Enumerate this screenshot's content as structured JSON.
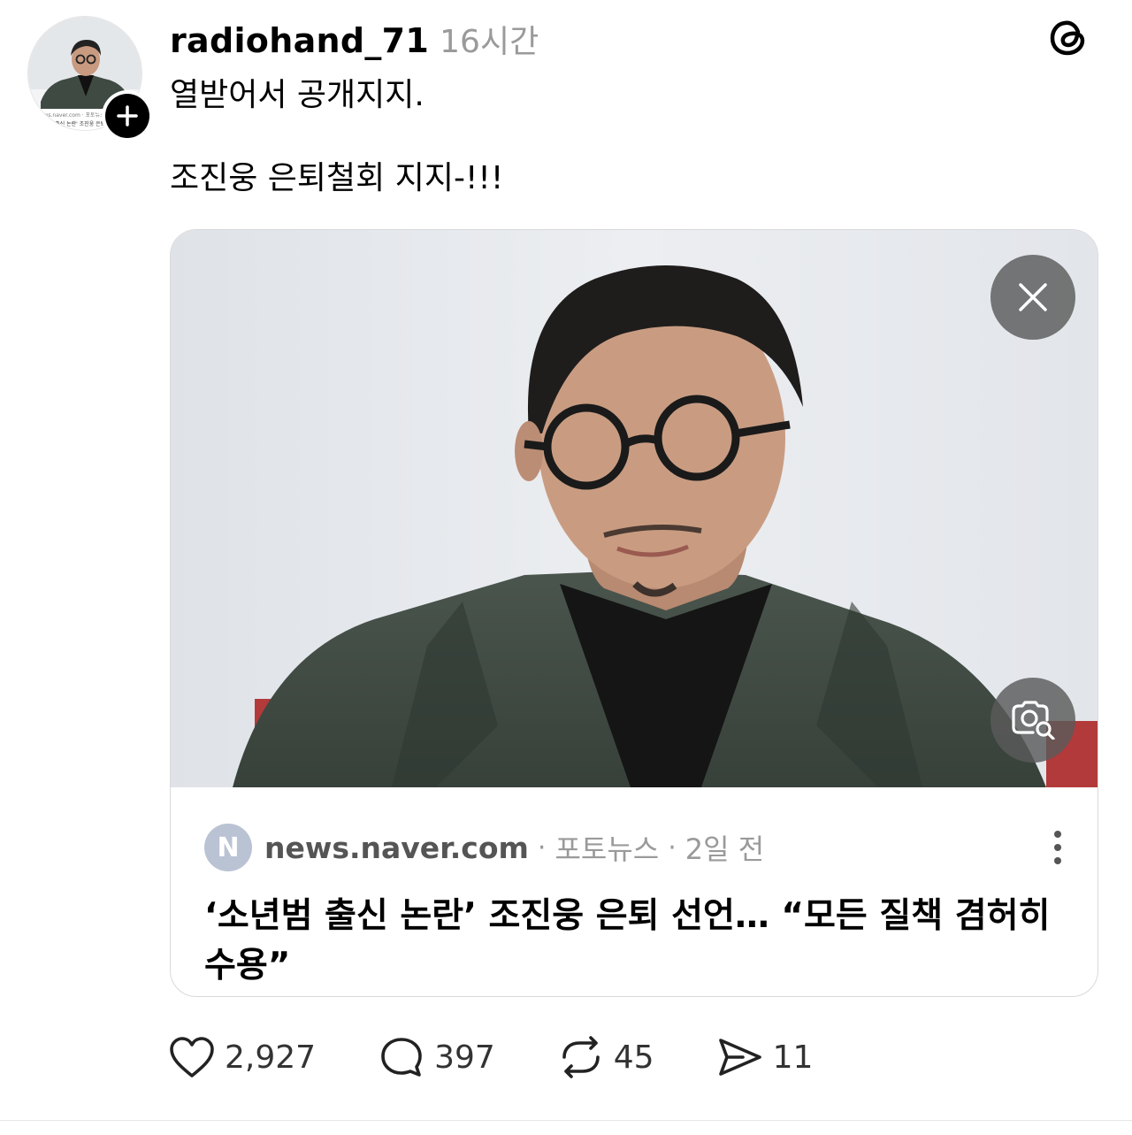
{
  "post": {
    "username": "radiohand_71",
    "timestamp": "16시간",
    "text_line1": "열받어서 공개지지.",
    "text_line2": "조진웅 은퇴철회 지지-!!!"
  },
  "link_card": {
    "favicon_letter": "N",
    "domain": "news.naver.com",
    "separator": "·",
    "section": "포토뉴스",
    "age": "2일 전",
    "headline": "‘소년범 출신 논란’ 조진웅 은퇴 선언… “모든 질책 겸허히 수용”",
    "avatar_caption_1": "news.naver.com · 포토뉴스 · 2일",
    "avatar_caption_2": "'소년범 출신 논란' 조진웅 은퇴 선언"
  },
  "actions": {
    "likes": "2,927",
    "replies": "397",
    "reposts": "45",
    "shares": "11"
  },
  "icons": {
    "app_logo": "threads-logo-icon",
    "follow": "plus-icon",
    "close": "close-icon",
    "visual_search": "lens-search-icon",
    "more": "more-vertical-icon",
    "like": "heart-icon",
    "reply": "comment-icon",
    "repost": "repost-icon",
    "share": "send-icon"
  },
  "colors": {
    "muted_text": "#9a9a9a",
    "favicon_bg": "#b9c3d3",
    "overlay_button": "#5a5a5a"
  }
}
